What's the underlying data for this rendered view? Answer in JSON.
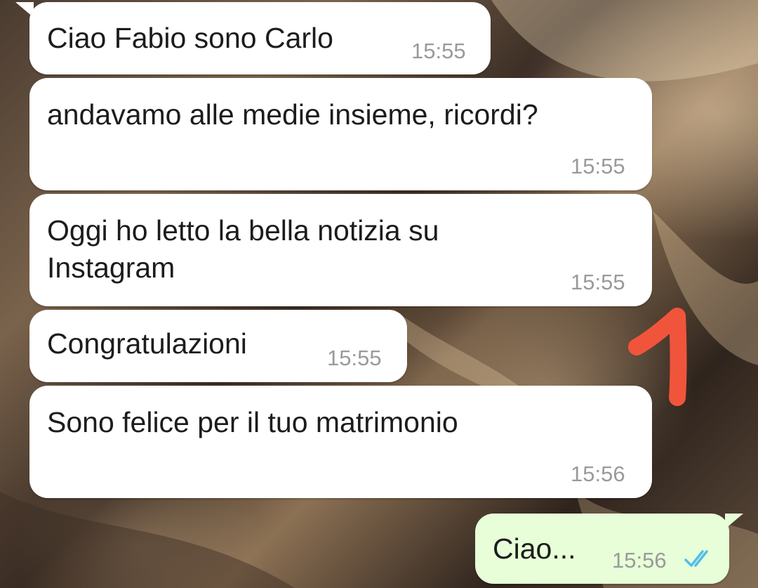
{
  "messages": [
    {
      "text": "Ciao Fabio sono Carlo",
      "time": "15:55",
      "direction": "incoming"
    },
    {
      "text": "andavamo alle medie insieme, ricordi?",
      "time": "15:55",
      "direction": "incoming"
    },
    {
      "text": "Oggi ho letto la bella notizia su\nInstagram",
      "time": "15:55",
      "direction": "incoming"
    },
    {
      "text": "Congratulazioni",
      "time": "15:55",
      "direction": "incoming"
    },
    {
      "text": "Sono felice per il tuo matrimonio",
      "time": "15:56",
      "direction": "incoming"
    },
    {
      "text": "Ciao...",
      "time": "15:56",
      "direction": "outgoing",
      "status_icon": "double-check-icon",
      "status": "read"
    }
  ],
  "colors": {
    "incoming_bubble": "#ffffff",
    "outgoing_bubble": "#e7fed8",
    "read_ticks": "#53bdeb",
    "annotation": "#f0553c"
  },
  "annotation_icon": "red-handdrawn-number-1"
}
